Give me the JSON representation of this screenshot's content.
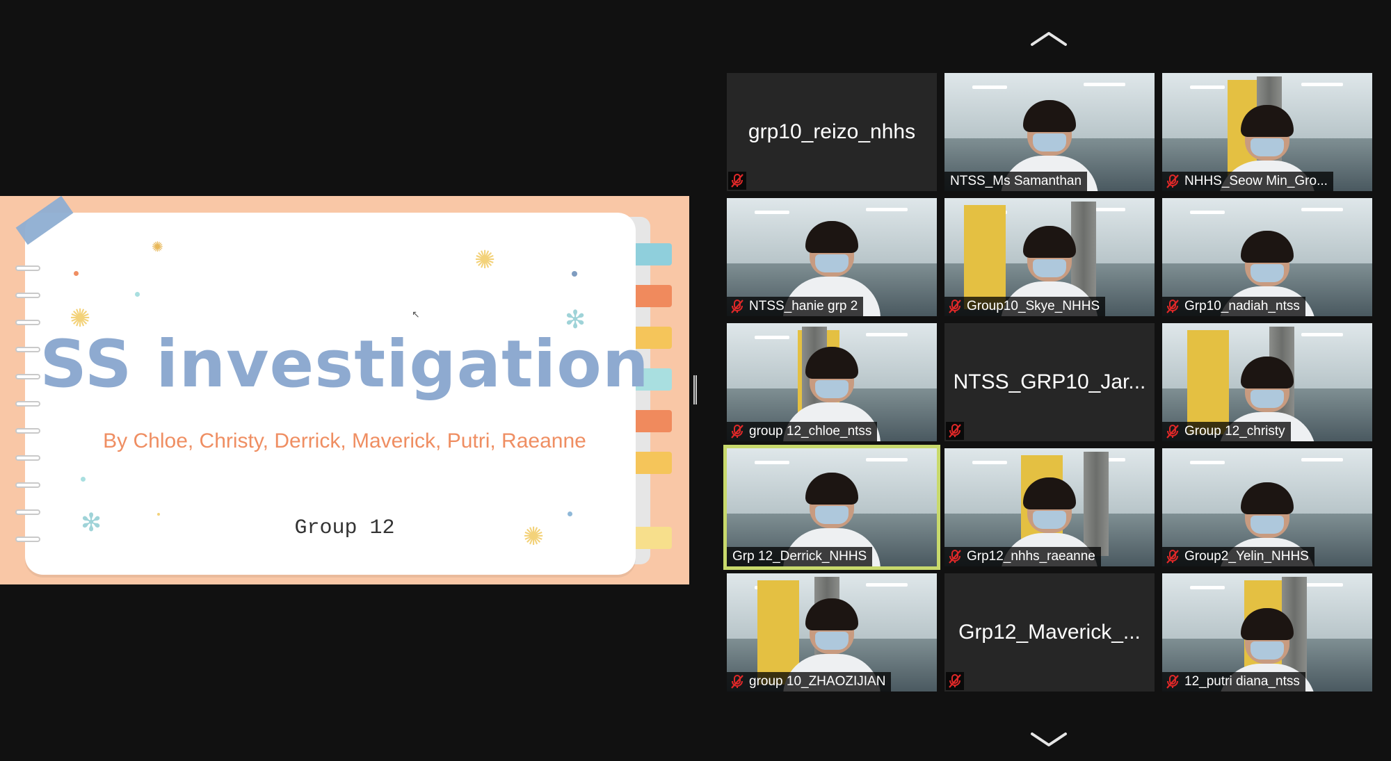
{
  "colors": {
    "accent_active": "#c8d96c",
    "mute_red": "#e02828",
    "background": "#111111"
  },
  "slide": {
    "title": "SS investigation",
    "subtitle": "By Chloe, Christy, Derrick, Maverick, Putri, Raeanne",
    "group": "Group 12"
  },
  "navigation": {
    "scroll_up": "chevron-up-icon",
    "scroll_down": "chevron-down-icon"
  },
  "participants": [
    {
      "name": "grp10_reizo_nhhs",
      "video": false,
      "muted": true
    },
    {
      "name": "NTSS_Ms Samanthan",
      "video": true,
      "muted": false
    },
    {
      "name": "NHHS_Seow Min_Gro...",
      "video": true,
      "muted": true
    },
    {
      "name": "NTSS_hanie grp 2",
      "video": true,
      "muted": true
    },
    {
      "name": "Group10_Skye_NHHS",
      "video": true,
      "muted": true
    },
    {
      "name": "Grp10_nadiah_ntss",
      "video": true,
      "muted": true
    },
    {
      "name": "group 12_chloe_ntss",
      "video": true,
      "muted": true
    },
    {
      "name": "NTSS_GRP10_Jar...",
      "video": false,
      "muted": true
    },
    {
      "name": "Group 12_christy",
      "video": true,
      "muted": true
    },
    {
      "name": "Grp 12_Derrick_NHHS",
      "video": true,
      "muted": false,
      "active_speaker": true
    },
    {
      "name": "Grp12_nhhs_raeanne",
      "video": true,
      "muted": true
    },
    {
      "name": "Group2_Yelin_NHHS",
      "video": true,
      "muted": true
    },
    {
      "name": "group 10_ZHAOZIJIAN",
      "video": true,
      "muted": true
    },
    {
      "name": "Grp12_Maverick_...",
      "video": false,
      "muted": true
    },
    {
      "name": "12_putri diana_ntss",
      "video": true,
      "muted": true
    }
  ]
}
